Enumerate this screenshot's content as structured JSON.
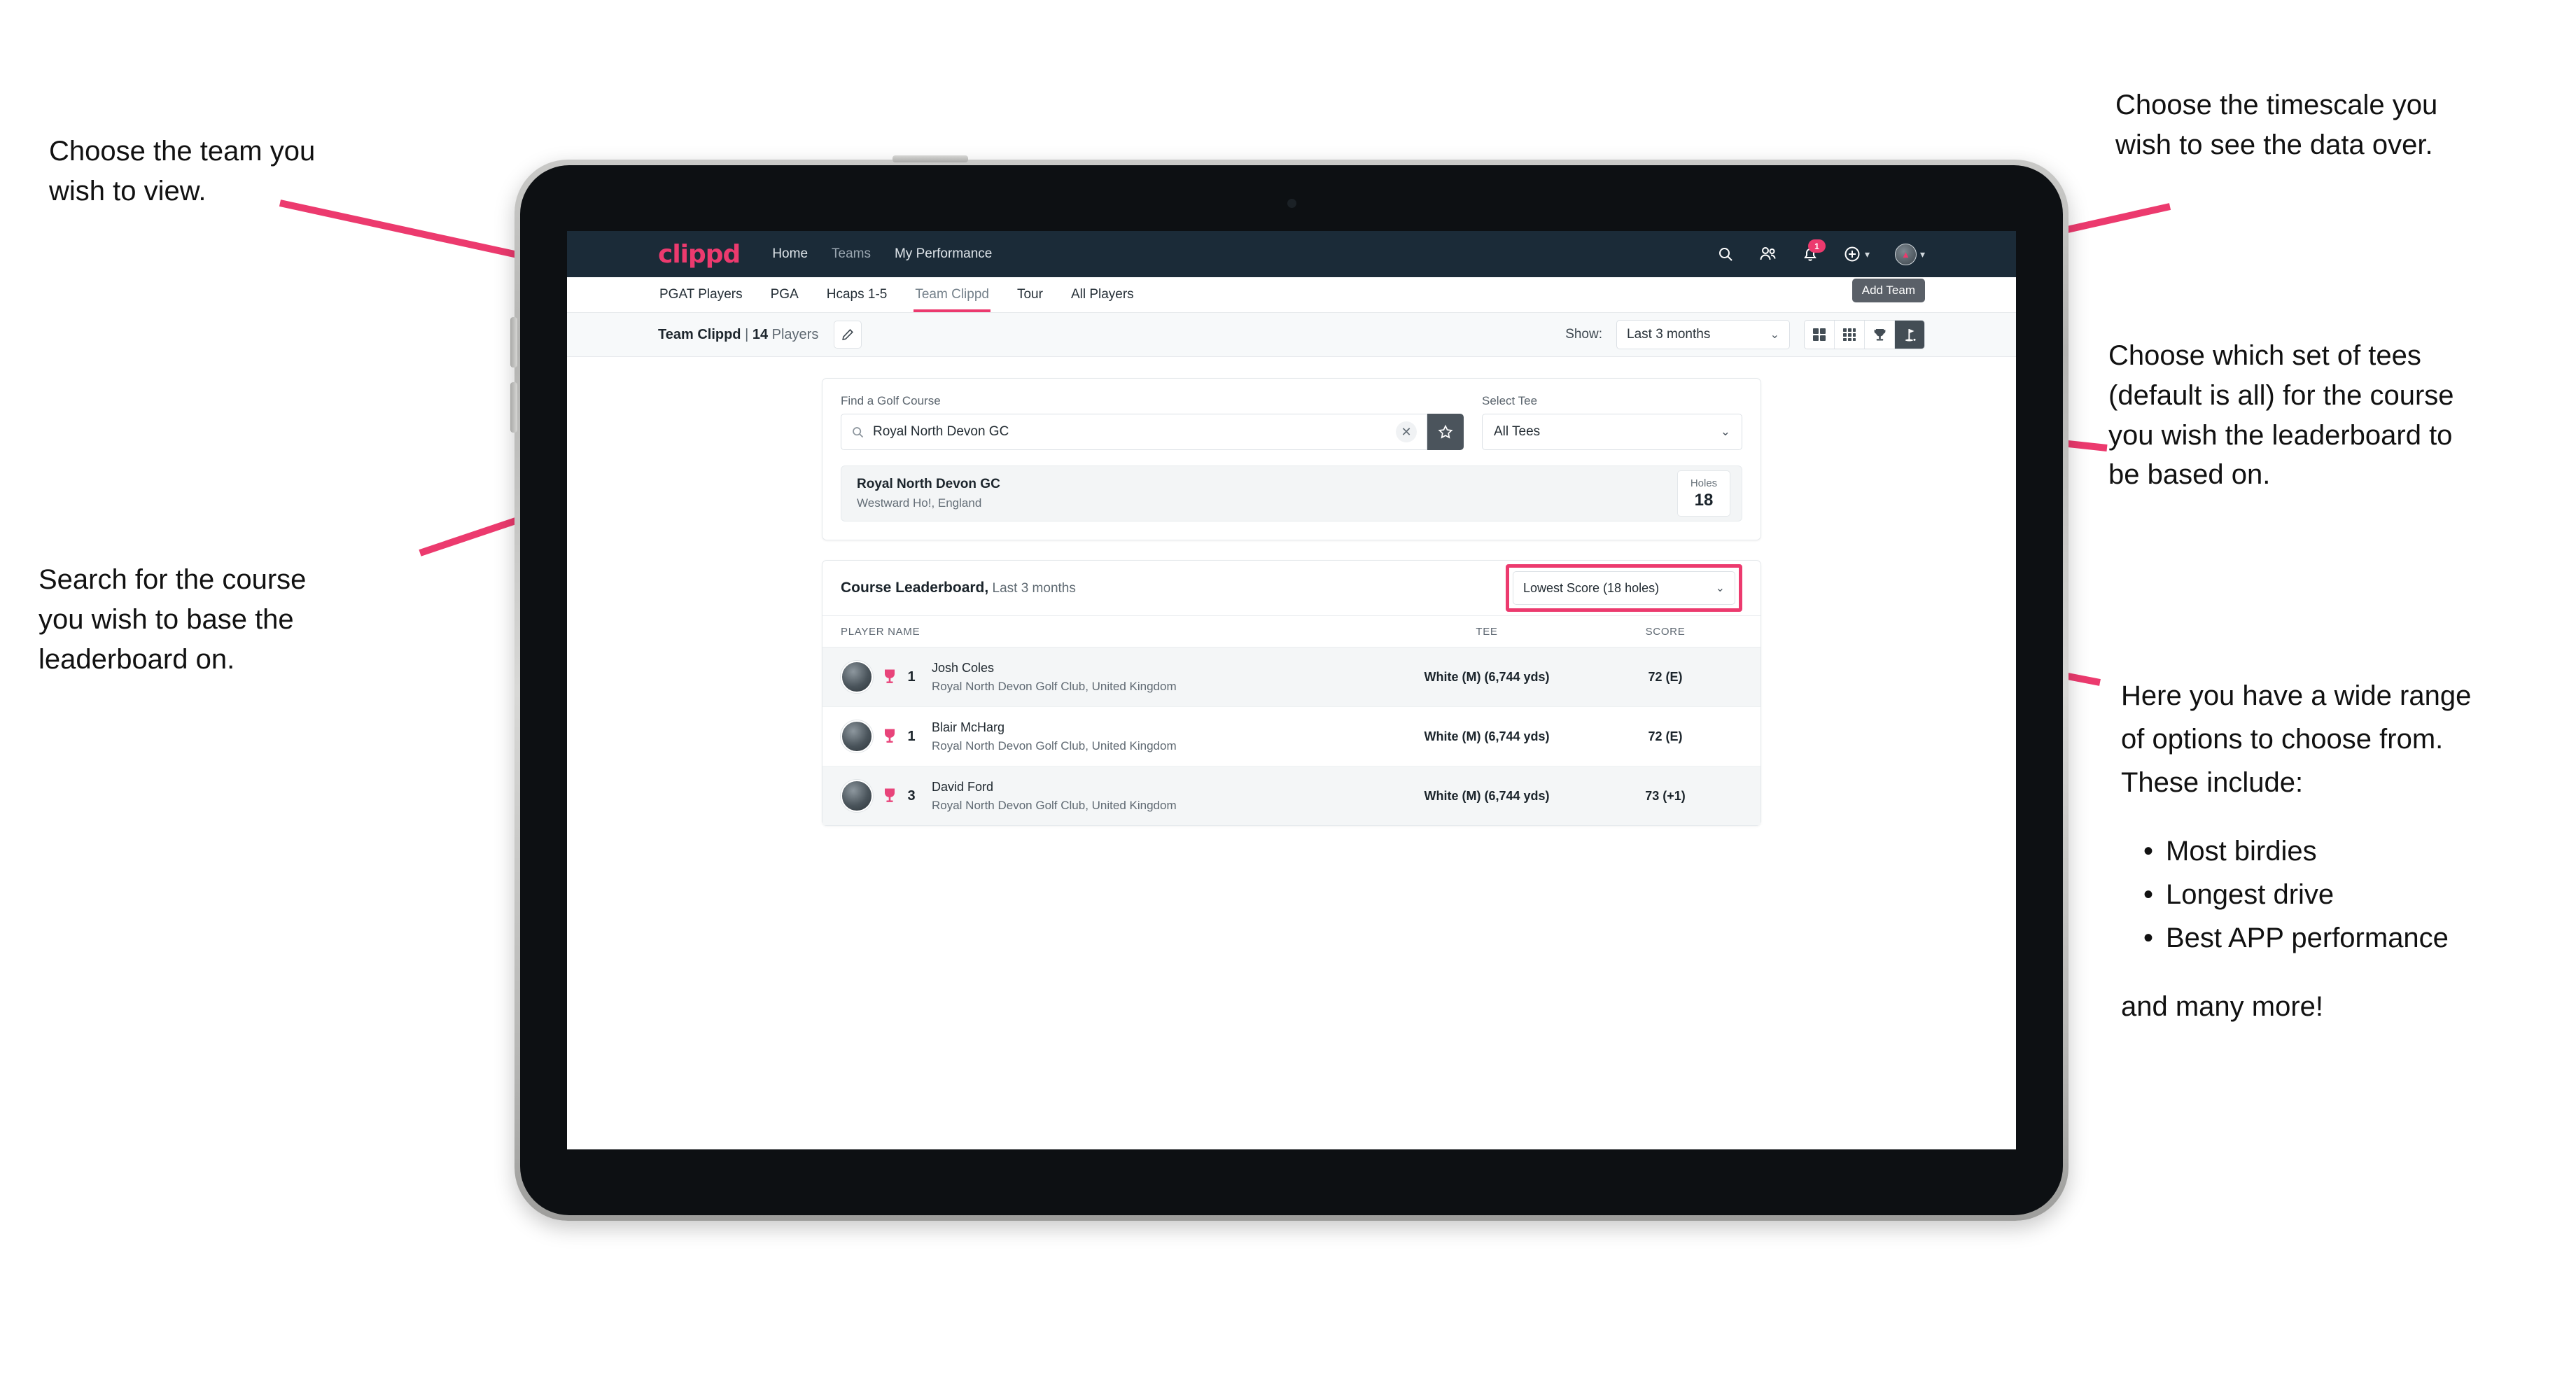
{
  "annotations": {
    "team": "Choose the team you\nwish to view.",
    "search": "Search for the course\nyou wish to base the\nleaderboard on.",
    "timescale": "Choose the timescale you\nwish to see the data over.",
    "tees": "Choose which set of tees\n(default is all) for the course\nyou wish the leaderboard to\nbe based on.",
    "options_intro": "Here you have a wide range\nof options to choose from.\nThese include:",
    "options_list": [
      "Most birdies",
      "Longest drive",
      "Best APP performance"
    ],
    "options_outro": "and many more!"
  },
  "app": {
    "brand": "clippd",
    "nav": [
      {
        "label": "Home",
        "active": true
      },
      {
        "label": "Teams",
        "active": false
      },
      {
        "label": "My Performance",
        "active": true
      }
    ],
    "header_icons": {
      "search": "search-icon",
      "people": "people-icon",
      "notifications": "bell-icon",
      "notification_count": "1",
      "add": "plus-circle-icon",
      "profile": "avatar-icon"
    },
    "tabs": [
      {
        "label": "PGAT Players",
        "active": false
      },
      {
        "label": "PGA",
        "active": false
      },
      {
        "label": "Hcaps 1-5",
        "active": false
      },
      {
        "label": "Team Clippd",
        "active": true
      },
      {
        "label": "Tour",
        "active": false
      },
      {
        "label": "All Players",
        "active": false
      }
    ],
    "tooltip": "Add Team",
    "toolbar": {
      "team_name": "Team Clippd",
      "separator": " | ",
      "player_count": "14",
      "players_word": " Players",
      "edit_icon": "pencil-icon",
      "show_label": "Show:",
      "timescale_value": "Last 3 months",
      "views": [
        {
          "name": "grid-2x2-view",
          "active": false
        },
        {
          "name": "grid-3x3-view",
          "active": false
        },
        {
          "name": "trophy-view",
          "active": false
        },
        {
          "name": "golf-flag-view",
          "active": true
        }
      ]
    },
    "search_card": {
      "course_label": "Find a Golf Course",
      "course_value": "Royal North Devon GC",
      "course_placeholder": "Find a Golf Course",
      "clear_icon": "close-icon",
      "favourite_icon": "star-icon",
      "tee_label": "Select Tee",
      "tee_value": "All Tees"
    },
    "course_result": {
      "name": "Royal North Devon GC",
      "location": "Westward Ho!, England",
      "holes_label": "Holes",
      "holes_value": "18"
    },
    "leaderboard": {
      "title": "Course Leaderboard,",
      "subtitle": " Last 3 months",
      "metric": "Lowest Score (18 holes)",
      "columns": [
        "PLAYER NAME",
        "TEE",
        "SCORE"
      ],
      "rows": [
        {
          "rank": "1",
          "name": "Josh Coles",
          "club": "Royal North Devon Golf Club, United Kingdom",
          "tee": "White (M) (6,744 yds)",
          "score": "72 (E)"
        },
        {
          "rank": "1",
          "name": "Blair McHarg",
          "club": "Royal North Devon Golf Club, United Kingdom",
          "tee": "White (M) (6,744 yds)",
          "score": "72 (E)"
        },
        {
          "rank": "3",
          "name": "David Ford",
          "club": "Royal North Devon Golf Club, United Kingdom",
          "tee": "White (M) (6,744 yds)",
          "score": "73 (+1)"
        }
      ]
    }
  },
  "colors": {
    "accent": "#ec3a6e",
    "header_bg": "#1b2b38",
    "dark_control": "#434d55"
  }
}
